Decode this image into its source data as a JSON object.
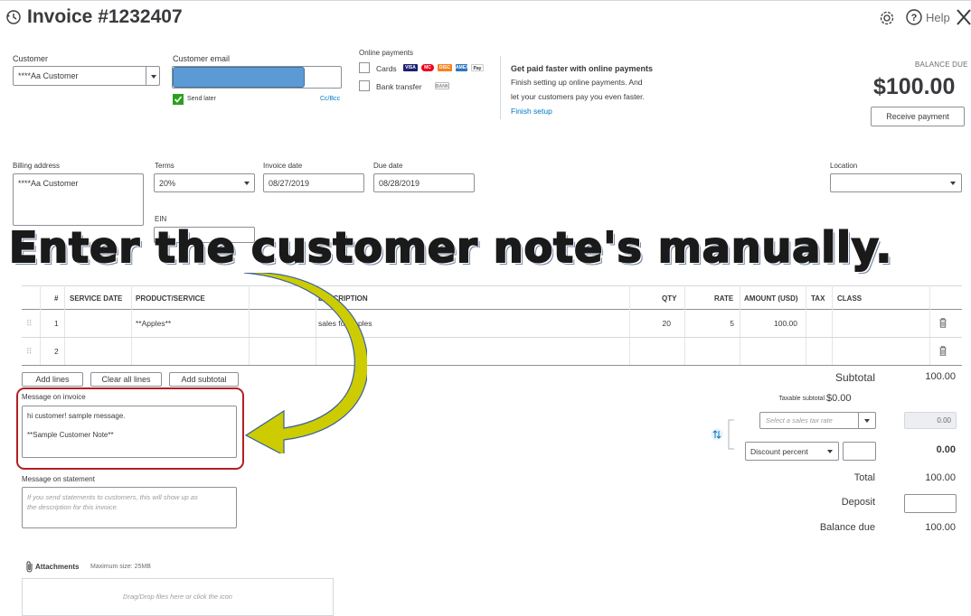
{
  "header": {
    "title": "Invoice #1232407",
    "help_label": "Help"
  },
  "customer": {
    "label": "Customer",
    "value": "****Aa Customer",
    "email_label": "Customer email",
    "send_later": "Send later",
    "cc_bcc": "Cc/Bcc"
  },
  "online_payments": {
    "label": "Online payments",
    "cards": "Cards",
    "bank_transfer": "Bank transfer",
    "card_logos": [
      "VISA",
      "MC",
      "DISC",
      "AMEX",
      "Pay"
    ],
    "bank_logo": "BANK"
  },
  "promo": {
    "title": "Get paid faster with online payments",
    "line1": "Finish setting up online payments. And",
    "line2": "let your customers pay you even faster.",
    "link": "Finish setup"
  },
  "balance": {
    "label": "BALANCE DUE",
    "amount": "$100.00",
    "receive_button": "Receive payment"
  },
  "billing": {
    "label": "Billing address",
    "value": "****Aa Customer",
    "terms_label": "Terms",
    "terms_value": "20%",
    "ein_label": "EIN",
    "invoice_date_label": "Invoice date",
    "invoice_date": "08/27/2019",
    "due_date_label": "Due date",
    "due_date": "08/28/2019",
    "location_label": "Location"
  },
  "overlay": {
    "caption": "Enter the customer note's manually."
  },
  "table": {
    "headers": [
      "#",
      "SERVICE DATE",
      "PRODUCT/SERVICE",
      "DESCRIPTION",
      "QTY",
      "RATE",
      "AMOUNT (USD)",
      "TAX",
      "CLASS"
    ],
    "rows": [
      {
        "num": "1",
        "service_date": "",
        "product": "**Apples**",
        "description": "sales for apples",
        "qty": "20",
        "rate": "5",
        "amount": "100.00"
      },
      {
        "num": "2",
        "service_date": "",
        "product": "",
        "description": "",
        "qty": "",
        "rate": "",
        "amount": ""
      }
    ]
  },
  "line_buttons": {
    "add_lines": "Add lines",
    "clear_all": "Clear all lines",
    "add_subtotal": "Add subtotal"
  },
  "message_invoice": {
    "label": "Message on invoice",
    "line1": "hi customer! sample message.",
    "line2": "**Sample Customer Note**"
  },
  "message_statement": {
    "label": "Message on statement",
    "placeholder_line1": "If you send statements to customers, this will show up as",
    "placeholder_line2": "the description for this invoice."
  },
  "totals": {
    "subtotal_label": "Subtotal",
    "subtotal_value": "100.00",
    "taxable_label": "Taxable subtotal",
    "taxable_value": "$0.00",
    "tax_rate_placeholder": "Select a sales tax rate",
    "tax_value": "0.00",
    "discount_label": "Discount percent",
    "discount_value": "0.00",
    "total_label": "Total",
    "total_value": "100.00",
    "deposit_label": "Deposit",
    "balance_label": "Balance due",
    "balance_value": "100.00"
  },
  "attachments": {
    "label": "Attachments",
    "max_size": "Maximum size: 25MB",
    "drop_text": "Drag/Drop files here or click the icon"
  },
  "colors": {
    "accent_blue": "#0077c5",
    "green_check": "#2ca01c",
    "highlight_red": "#b22024",
    "arrow_yellow": "#cccc00",
    "email_fill": "#5b9bd5"
  }
}
